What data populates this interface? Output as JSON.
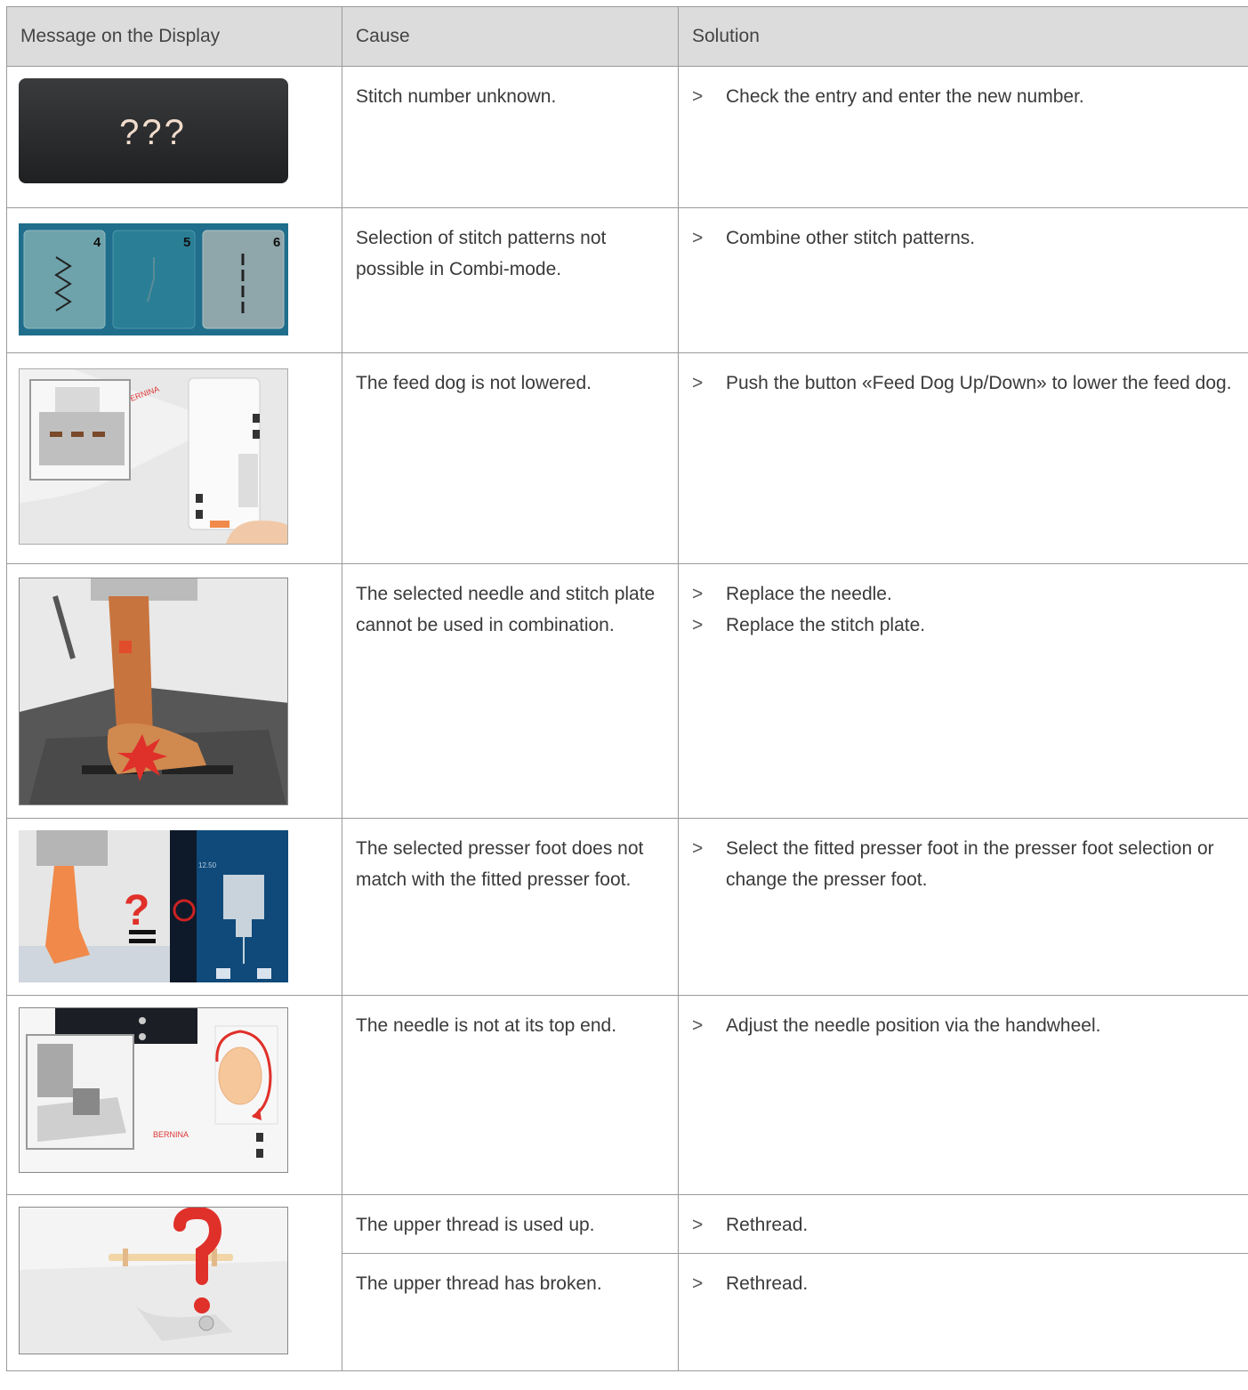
{
  "header": {
    "col1": "Message on the Display",
    "col2": "Cause",
    "col3": "Solution"
  },
  "rows": [
    {
      "image_icon": "stitch-unknown-display-icon",
      "image_text": "???",
      "cause": "Stitch number unknown.",
      "solutions": [
        "Check the entry and enter the new number."
      ]
    },
    {
      "image_icon": "stitch-pattern-keys-icon",
      "image_numbers": [
        "4",
        "5",
        "6"
      ],
      "cause": "Selection of stitch patterns not possible in Combi-mode.",
      "solutions": [
        "Combine other stitch patterns."
      ]
    },
    {
      "image_icon": "feed-dog-button-icon",
      "image_logo": "BERNINA",
      "cause": "The feed dog is not lowered.",
      "solutions": [
        "Push the button «Feed Dog Up/Down» to lower the feed dog."
      ]
    },
    {
      "image_icon": "needle-stitch-plate-conflict-icon",
      "cause": "The selected needle and stitch plate cannot be used in combination.",
      "solutions": [
        "Replace the needle.",
        "Replace the stitch plate."
      ]
    },
    {
      "image_icon": "presser-foot-mismatch-icon",
      "image_value": "12.50",
      "cause": "The selected presser foot does not match with the fitted presser foot.",
      "solutions": [
        "Select the fitted presser foot in the presser foot selection or change the presser foot."
      ]
    },
    {
      "image_icon": "handwheel-needle-position-icon",
      "image_logo": "BERNINA",
      "cause": "The needle is not at its top end.",
      "solutions": [
        "Adjust the needle position via the handwheel."
      ]
    },
    {
      "image_icon": "upper-thread-question-icon",
      "cause": "The upper thread is used up.",
      "solutions": [
        "Rethread."
      ]
    },
    {
      "cause": "The upper thread has broken.",
      "solutions": [
        "Rethread."
      ]
    }
  ],
  "bullet_glyph": ">",
  "colors": {
    "header_bg": "#dcdcdc",
    "border": "#9a9a9a",
    "alert_red": "#e0302a",
    "accent_orange": "#f08a4b"
  }
}
